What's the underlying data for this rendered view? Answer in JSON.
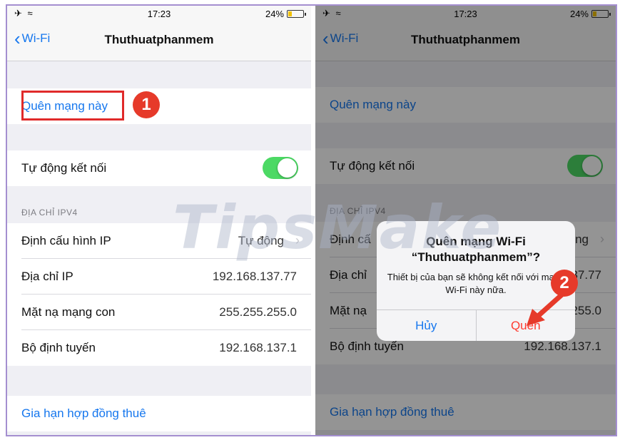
{
  "status_bar": {
    "time": "17:23",
    "battery": "24%",
    "battery_level": 0.24,
    "left_icons": "✈ ≈"
  },
  "nav": {
    "back_label": "Wi-Fi",
    "title": "Thuthuatphanmem"
  },
  "forget_network_label": "Quên mạng này",
  "auto_join_label": "Tự động kết nối",
  "auto_join_on": true,
  "ipv4_header": "ĐỊA CHỈ IPV4",
  "ip_rows": [
    {
      "label": "Định cấu hình IP",
      "value": "Tự động"
    },
    {
      "label": "Địa chỉ IP",
      "value": "192.168.137.77"
    },
    {
      "label": "Mặt nạ mạng con",
      "value": "255.255.255.0"
    },
    {
      "label": "Bộ định tuyến",
      "value": "192.168.137.1"
    }
  ],
  "renew_lease_label": "Gia hạn hợp đồng thuê",
  "right_panel": {
    "ip_rows": [
      {
        "label": "Định cấ",
        "value": "động"
      },
      {
        "label": "Địa chỉ",
        "value": "137.77"
      },
      {
        "label": "Mặt nạ",
        "value": ".255.0"
      },
      {
        "label": "Bộ định tuyến",
        "value": "192.168.137.1"
      }
    ]
  },
  "alert": {
    "title_line1": "Quên mạng Wi-Fi",
    "title_line2": "“Thuthuatphanmem”?",
    "message": "Thiết bị của bạn sẽ không kết nối với mạng Wi-Fi này nữa.",
    "cancel_label": "Hủy",
    "confirm_label": "Quên"
  },
  "steps": {
    "step1": "1",
    "step2": "2"
  },
  "watermark": "TipsMake",
  "colors": {
    "accent": "#1677ee",
    "toggle": "#4cd964",
    "destructive": "#ff3b30",
    "annotation": "#e02a2a"
  }
}
